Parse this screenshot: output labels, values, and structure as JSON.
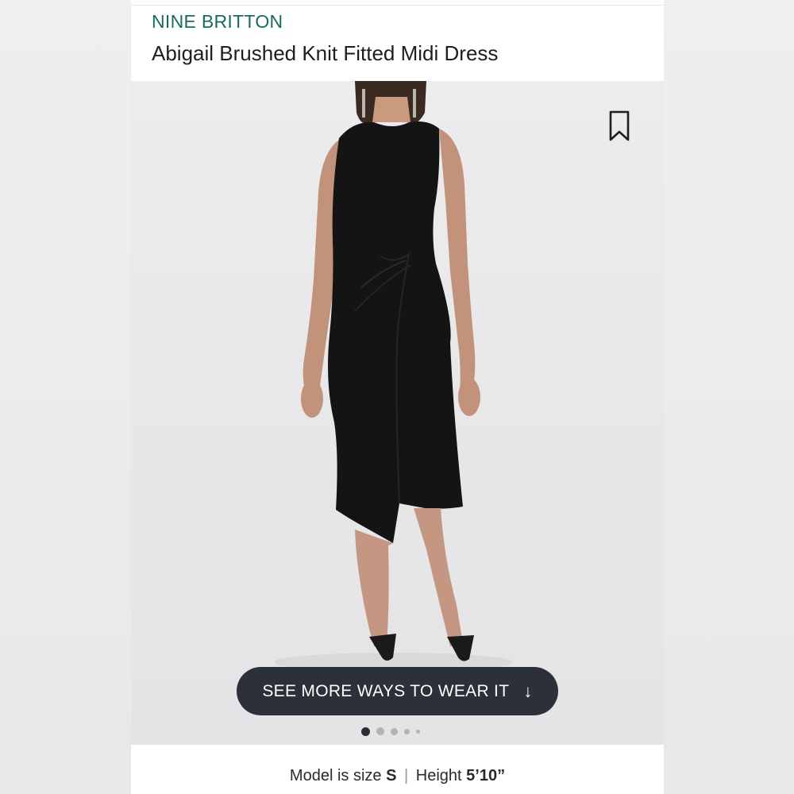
{
  "product": {
    "brand": "NINE BRITTON",
    "title": "Abigail Brushed Knit Fitted Midi Dress"
  },
  "gallery": {
    "cta_label": "SEE MORE WAYS TO WEAR IT",
    "cta_icon": "arrow-down-icon",
    "bookmark_icon": "bookmark-icon",
    "image_count": 5,
    "active_image": 1
  },
  "fit_info": {
    "model_size_label": "Model is size",
    "model_size": "S",
    "separator": "|",
    "height_label": "Height",
    "height": "5’10”"
  },
  "colors": {
    "brand": "#1a6b5f",
    "cta_background": "#2c3038",
    "dress": "#141414"
  }
}
